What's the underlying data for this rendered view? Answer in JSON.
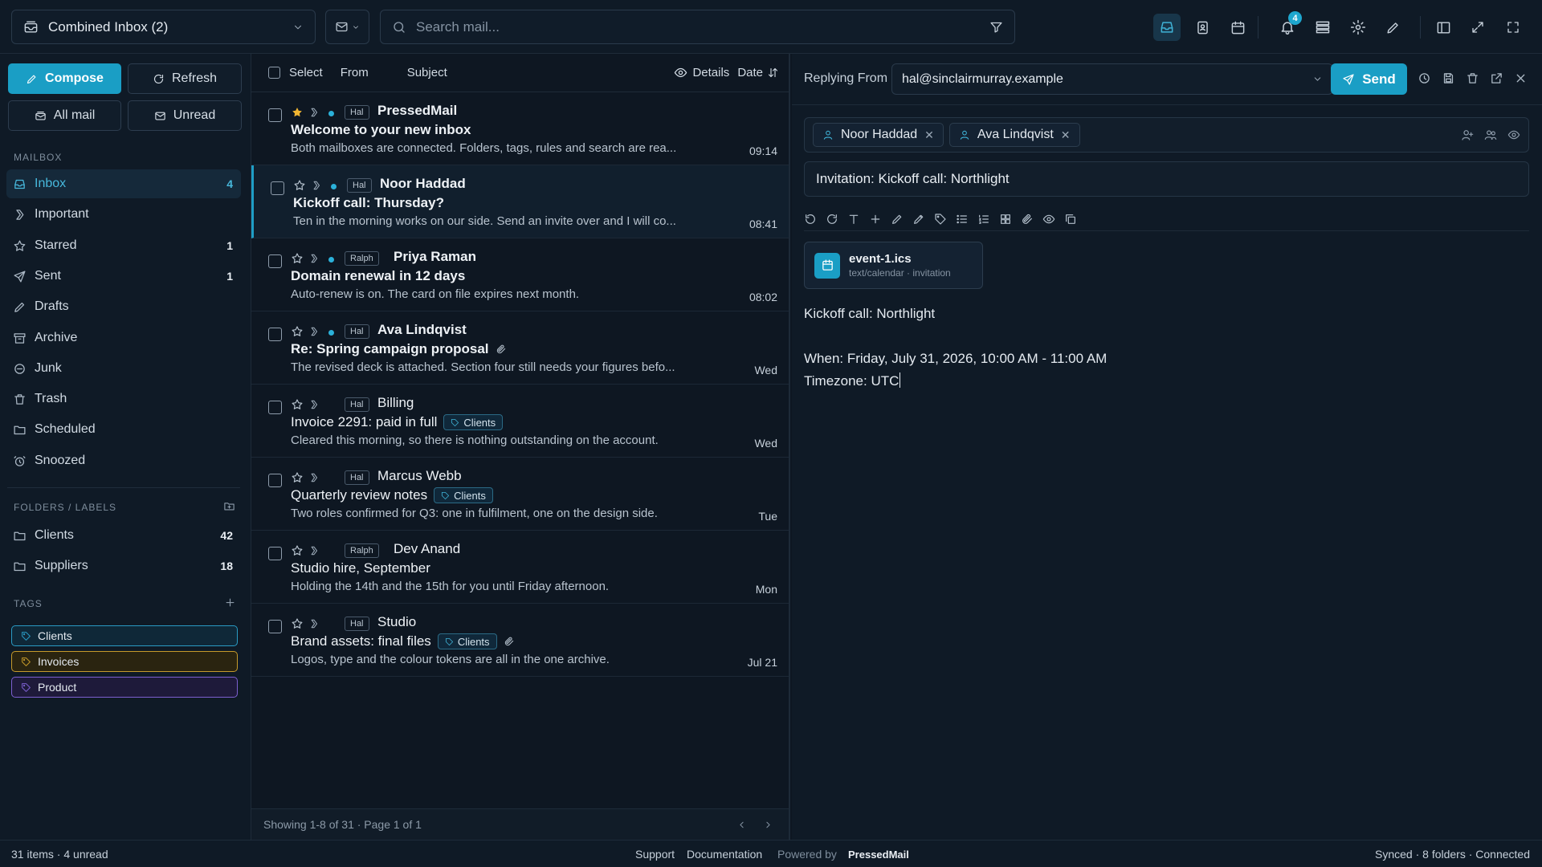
{
  "topbar": {
    "account_label": "Combined Inbox (2)",
    "search_placeholder": "Search mail...",
    "notifications_count": "4"
  },
  "sidebar": {
    "compose": "Compose",
    "refresh": "Refresh",
    "all_mail": "All mail",
    "unread": "Unread",
    "mailbox_heading": "MAILBOX",
    "mailbox": [
      {
        "label": "Inbox",
        "count": "4",
        "icon": "inbox-icon"
      },
      {
        "label": "Important",
        "count": "",
        "icon": "important-icon"
      },
      {
        "label": "Starred",
        "count": "1",
        "icon": "star-icon"
      },
      {
        "label": "Sent",
        "count": "1",
        "icon": "send-icon"
      },
      {
        "label": "Drafts",
        "count": "",
        "icon": "pencil-icon"
      },
      {
        "label": "Archive",
        "count": "",
        "icon": "archive-icon"
      },
      {
        "label": "Junk",
        "count": "",
        "icon": "junk-icon"
      },
      {
        "label": "Trash",
        "count": "",
        "icon": "trash-icon"
      },
      {
        "label": "Scheduled",
        "count": "",
        "icon": "folder-icon"
      },
      {
        "label": "Snoozed",
        "count": "",
        "icon": "alarm-icon"
      }
    ],
    "folders_heading": "FOLDERS / LABELS",
    "folders": [
      {
        "label": "Clients",
        "count": "42"
      },
      {
        "label": "Suppliers",
        "count": "18"
      }
    ],
    "tags_heading": "TAGS",
    "tags": [
      {
        "label": "Clients",
        "color": "#2a9bc4",
        "bg": "#0f2838"
      },
      {
        "label": "Invoices",
        "color": "#c69a2a",
        "bg": "#2a2410"
      },
      {
        "label": "Product",
        "color": "#7d5fd0",
        "bg": "#1e1a3a"
      }
    ]
  },
  "list": {
    "header": {
      "select": "Select",
      "from": "From",
      "subject": "Subject",
      "details": "Details",
      "date": "Date"
    },
    "rows": [
      {
        "account": "Hal",
        "from": "PressedMail",
        "subject": "Welcome to your new inbox",
        "preview": "Both mailboxes are connected. Folders, tags, rules and search are rea...",
        "time": "09:14",
        "unread": true,
        "starred": true,
        "label": "",
        "attach": false
      },
      {
        "account": "Hal",
        "from": "Noor Haddad",
        "subject": "Kickoff call: Thursday?",
        "preview": "Ten in the morning works on our side. Send an invite over and I will co...",
        "time": "08:41",
        "unread": true,
        "starred": false,
        "label": "",
        "attach": false
      },
      {
        "account": "Ralph",
        "from": "Priya Raman",
        "subject": "Domain renewal in 12 days",
        "preview": "Auto-renew is on. The card on file expires next month.",
        "time": "08:02",
        "unread": true,
        "starred": false,
        "label": "",
        "attach": false
      },
      {
        "account": "Hal",
        "from": "Ava Lindqvist",
        "subject": "Re: Spring campaign proposal",
        "preview": "The revised deck is attached. Section four still needs your figures befo...",
        "time": "Wed",
        "unread": true,
        "starred": false,
        "label": "",
        "attach": true
      },
      {
        "account": "Hal",
        "from": "Billing",
        "subject": "Invoice 2291: paid in full",
        "preview": "Cleared this morning, so there is nothing outstanding on the account.",
        "time": "Wed",
        "unread": false,
        "starred": false,
        "label": "Clients",
        "attach": false
      },
      {
        "account": "Hal",
        "from": "Marcus Webb",
        "subject": "Quarterly review notes",
        "preview": "Two roles confirmed for Q3: one in fulfilment, one on the design side.",
        "time": "Tue",
        "unread": false,
        "starred": false,
        "label": "Clients",
        "attach": false
      },
      {
        "account": "Ralph",
        "from": "Dev Anand",
        "subject": "Studio hire, September",
        "preview": "Holding the 14th and the 15th for you until Friday afternoon.",
        "time": "Mon",
        "unread": false,
        "starred": false,
        "label": "",
        "attach": false
      },
      {
        "account": "Hal",
        "from": "Studio",
        "subject": "Brand assets: final files",
        "preview": "Logos, type and the colour tokens are all in the one archive.",
        "time": "Jul 21",
        "unread": false,
        "starred": false,
        "label": "Clients",
        "attach": true
      }
    ],
    "footer": "Showing 1-8 of 31 · Page 1 of 1"
  },
  "reply": {
    "replying_from_label": "Replying From",
    "from_address": "hal@sinclairmurray.example",
    "send": "Send",
    "recipients": [
      "Noor Haddad",
      "Ava Lindqvist"
    ],
    "subject": "Invitation: Kickoff call: Northlight",
    "attachment": {
      "name": "event-1.ics",
      "meta": "text/calendar · invitation"
    },
    "body": {
      "line1": "Kickoff call: Northlight",
      "line2": "When: Friday, July 31, 2026, 10:00 AM - 11:00 AM",
      "line3": "Timezone: UTC"
    }
  },
  "status": {
    "left": "31 items · 4 unread",
    "support": "Support",
    "documentation": "Documentation",
    "powered_by": "Powered by",
    "brand": "PressedMail",
    "right": "Synced · 8 folders · Connected"
  }
}
